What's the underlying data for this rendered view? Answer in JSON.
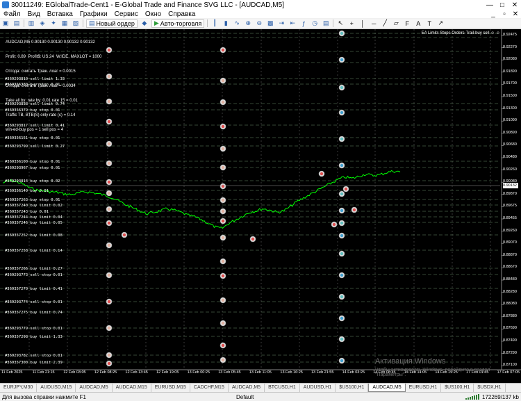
{
  "window": {
    "title": "30011249: EGlobalTrade-Cent1 - E-Global Trade and Finance SVG LLC - [AUDCAD,M5]",
    "btn_minimize": "—",
    "btn_maximize": "□",
    "btn_close": "✕"
  },
  "menu": {
    "items": [
      "Файл",
      "Вид",
      "Вставка",
      "Графики",
      "Сервис",
      "Окно",
      "Справка"
    ],
    "mdi_minimize": "_",
    "mdi_restore": "▫",
    "mdi_close": "✕"
  },
  "toolbar": {
    "new_order": "Новый ордер",
    "auto_trading": "Авто-торговля"
  },
  "chart": {
    "symbol": "AUDCAD,M5",
    "info_lines": [
      "AUDCAD,M5 0.90130 0.90130 0.90132 0.90132",
      "Profit: 0.89  Profit$: US.24  W:IDE, MAXLOT = 1000",
      "Отгода: считать Траж. лоаг = 0.0015",
      "Отгода: считать Траж. лоаг = 0.0034",
      "Take all by: rate by: 0.01 rate 15 = 0.01",
      "Traffic TB, BTB(S) only rate (c) = 0.14",
      "win-ed-buy pos = 1 sell pos = 4"
    ],
    "ea_label": "EA Limits Steps Orders-Trail-buy sell ☺ ☺",
    "current_price": "0.90132",
    "price_levels": [
      "0.92475",
      "0.92270",
      "0.92080",
      "0.91890",
      "0.91700",
      "0.91500",
      "0.91300",
      "0.91090",
      "0.90890",
      "0.90680",
      "0.90480",
      "0.90260",
      "0.90080",
      "0.89870",
      "0.89675",
      "0.89455",
      "0.89260",
      "0.89070",
      "0.88870",
      "0.88670",
      "0.88480",
      "0.88280",
      "0.88080",
      "0.87880",
      "0.87690",
      "0.87490",
      "0.87290",
      "0.87100"
    ],
    "time_labels": [
      "11 Feb 2025",
      "11 Feb 21:15",
      "12 Feb 03:05",
      "12 Feb 08:25",
      "12 Feb 13:45",
      "12 Feb 19:05",
      "13 Feb 00:25",
      "13 Feb 05:45",
      "13 Feb 11:05",
      "13 Feb 16:25",
      "13 Feb 21:55",
      "14 Feb 03:25",
      "14 Feb 08:45",
      "14 Feb 14:05",
      "14 Feb 19:25",
      "17 Feb 01:45",
      "17 Feb 07:05"
    ],
    "order_labels": [
      "#369293810 sell limit 1.33",
      "#369356380 buy stop 0.01",
      "#369293838 sell limit 0.74",
      "#369356379 buy stop 0.01",
      "#369293817 sell limit 0.41",
      "#369356151 buy stop 0.01",
      "#369293799 sell limit 0.27",
      "#369356100 buy stop 0.01",
      "#369293967 buy stop 0.01",
      "#369293814 buy stop 0.02",
      "#369356149 buy 0.01",
      "#369357263 buy stop 0.01",
      "#369357240 buy limit 0.02",
      "#369357243 buy 0.01",
      "#369357244 buy limit 0.04",
      "#369357246 buy limit 0.05",
      "#369357252 buy limit 0.08",
      "#369357258 buy limit 0.14",
      "#369357266 buy limit 0.27",
      "#369293773 sell stop 0.01",
      "#369357270 buy limit 0.41",
      "#369293774 sell stop 0.01",
      "#369357275 buy limit 0.74",
      "#369293779 sell stop 0.01",
      "#369357298 buy limit 1.33",
      "#369293782 sell stop 0.01",
      "#369357300 buy limit 2.39"
    ],
    "watermark_title": "Активация Windows",
    "watermark_sub": "Чтобы активировать Windows, перейдите в раздел \"Параметры\"."
  },
  "tabs": [
    {
      "label": "EURJPY,M30",
      "active": false
    },
    {
      "label": "AUDUSD,M15",
      "active": false
    },
    {
      "label": "AUDCAD,M5",
      "active": false
    },
    {
      "label": "AUDCAD,M15",
      "active": false
    },
    {
      "label": "EURUSD,M15",
      "active": false
    },
    {
      "label": "CADCHF,M15",
      "active": false
    },
    {
      "label": "AUDCAD,M5",
      "active": false
    },
    {
      "label": "BTCUSD,H1",
      "active": false
    },
    {
      "label": "AUDUSD,H1",
      "active": false
    },
    {
      "label": "$US100,H1",
      "active": false
    },
    {
      "label": "AUDCAD,M5",
      "active": true
    },
    {
      "label": "EURUSD,H1",
      "active": false
    },
    {
      "label": "$US100,H1",
      "active": false
    },
    {
      "label": "$USDX,H1",
      "active": false
    }
  ],
  "status": {
    "help": "Для вызова справки нажмите F1",
    "profile": "Default",
    "traffic": "172269/137 kb"
  },
  "colors": {
    "chart_bg": "#000000",
    "price_line": "#00ff00",
    "grid": "#3a3a3a",
    "order_line": "#90c090",
    "marker_red": "#e05050",
    "marker_blue": "#40a0d0"
  },
  "series": {
    "price_curve": [
      0.901,
      0.9013,
      0.9012,
      0.9008,
      0.9003,
      0.9,
      0.8999,
      0.8998,
      0.8997,
      0.8995,
      0.8994,
      0.8996,
      0.8998,
      0.8997,
      0.8995,
      0.8993,
      0.899,
      0.8985,
      0.898,
      0.8976,
      0.8972,
      0.8968,
      0.897,
      0.8972,
      0.8975,
      0.8973,
      0.897,
      0.8966,
      0.8964,
      0.896,
      0.8955,
      0.895,
      0.8948,
      0.8955,
      0.896,
      0.8965,
      0.897,
      0.8972,
      0.8975,
      0.8973,
      0.897,
      0.8972,
      0.8978,
      0.8985,
      0.899,
      0.8995,
      0.9,
      0.9005,
      0.901,
      0.9015,
      0.9018,
      0.9016,
      0.9019,
      0.9022,
      0.902,
      0.9021,
      0.9024,
      0.9026,
      0.9025
    ]
  }
}
